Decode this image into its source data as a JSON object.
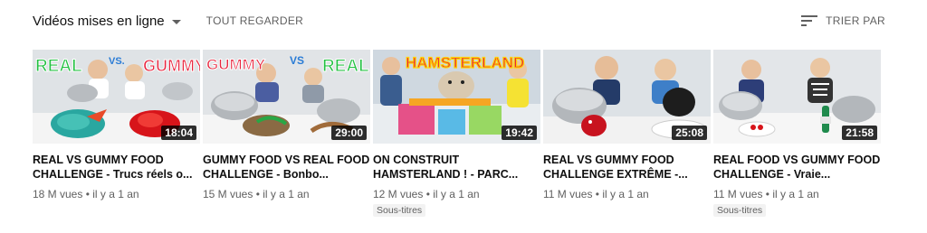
{
  "header": {
    "section_title": "Vidéos mises en ligne",
    "see_all": "TOUT REGARDER",
    "sort_by": "TRIER PAR"
  },
  "videos": [
    {
      "title": "REAL VS GUMMY FOOD CHALLENGE - Trucs réels o...",
      "meta": "18 M vues • il y a 1 an",
      "duration": "18:04",
      "badge": "",
      "thumb_text_left": "REAL",
      "thumb_text_mid": "VS.",
      "thumb_text_right": "GUMMY"
    },
    {
      "title": "GUMMY FOOD VS REAL FOOD CHALLENGE - Bonbo...",
      "meta": "15 M vues • il y a 1 an",
      "duration": "29:00",
      "badge": "",
      "thumb_text_left": "GUMMY",
      "thumb_text_mid": "VS",
      "thumb_text_right": "REAL"
    },
    {
      "title": "ON CONSTRUIT HAMSTERLAND ! - PARC...",
      "meta": "12 M vues • il y a 1 an",
      "duration": "19:42",
      "badge": "Sous-titres",
      "thumb_text_left": "HAMSTERLAND",
      "thumb_text_mid": "",
      "thumb_text_right": ""
    },
    {
      "title": "REAL VS GUMMY FOOD CHALLENGE EXTRÊME -...",
      "meta": "11 M vues • il y a 1 an",
      "duration": "25:08",
      "badge": "",
      "thumb_text_left": "",
      "thumb_text_mid": "",
      "thumb_text_right": ""
    },
    {
      "title": "REAL FOOD VS GUMMY FOOD CHALLENGE - Vraie...",
      "meta": "11 M vues • il y a 1 an",
      "duration": "21:58",
      "badge": "Sous-titres",
      "thumb_text_left": "",
      "thumb_text_mid": "",
      "thumb_text_right": ""
    }
  ],
  "colors": {
    "text_primary": "#0f0f0f",
    "text_secondary": "#606060",
    "duration_bg": "#000000",
    "badge_bg": "#f2f2f2"
  },
  "icons": {
    "section_dropdown": "chevron-down-icon",
    "sort": "sort-icon"
  }
}
